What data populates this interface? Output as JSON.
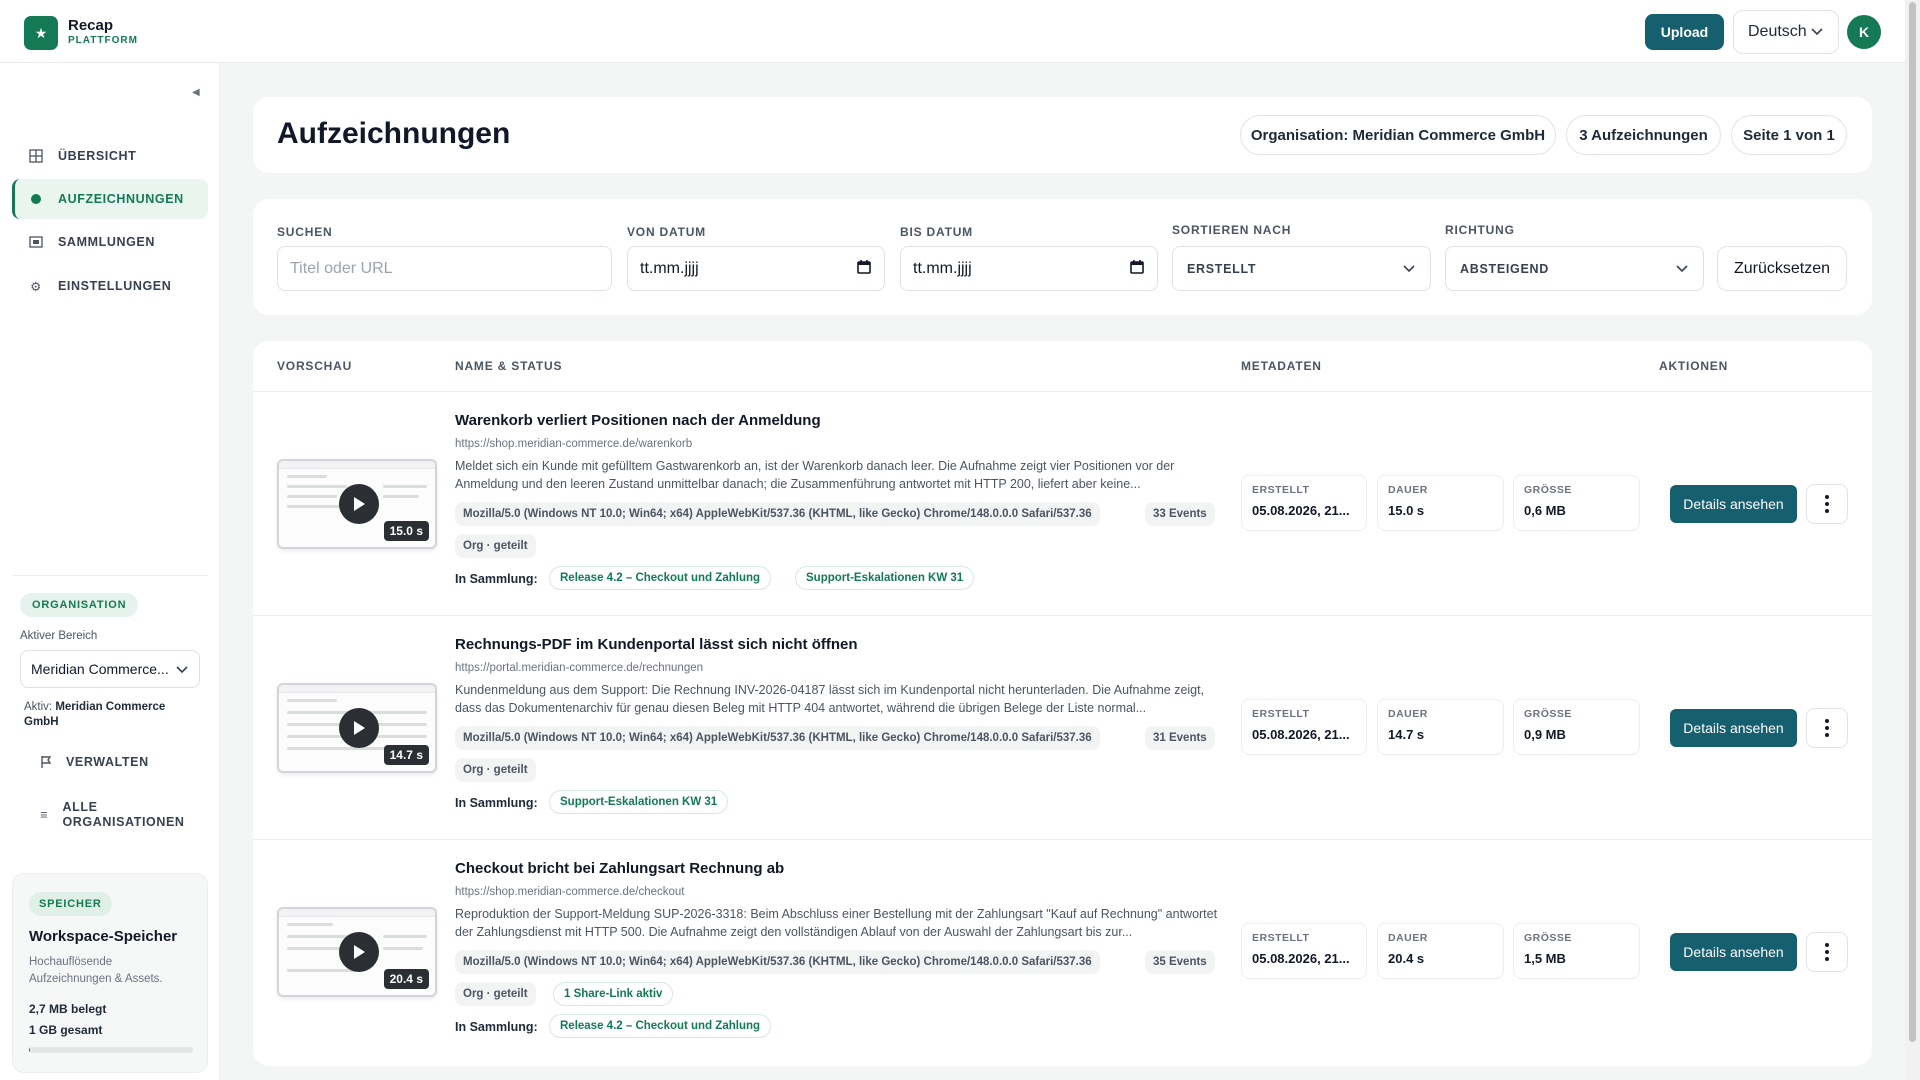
{
  "app": {
    "name": "Recap",
    "subtitle": "PLATTFORM"
  },
  "header": {
    "upload_label": "Upload",
    "language": "Deutsch",
    "avatar_initial": "K"
  },
  "sidebar": {
    "nav": [
      {
        "label": "ÜBERSICHT",
        "icon": "grid-icon",
        "active": false
      },
      {
        "label": "AUFZEICHNUNGEN",
        "icon": "record-dot-icon",
        "active": true
      },
      {
        "label": "SAMMLUNGEN",
        "icon": "collection-icon",
        "active": false
      },
      {
        "label": "EINSTELLUNGEN",
        "icon": "gear-icon",
        "active": false
      }
    ],
    "org_pill": "ORGANISATION",
    "area_label": "Aktiver Bereich",
    "org_select_value": "Meridian Commerce...",
    "active_prefix": "Aktiv:",
    "active_org": "Meridian Commerce GmbH",
    "manage_label": "VERWALTEN",
    "all_orgs_label": "ALLE ORGANISATIONEN",
    "storage": {
      "pill": "SPEICHER",
      "title": "Workspace-Speicher",
      "desc": "Hochauflösende Aufzeichnungen & Assets.",
      "used": "2,7 MB belegt",
      "total": "1 GB gesamt",
      "used_fraction": 0.0027
    }
  },
  "main": {
    "title": "Aufzeichnungen",
    "chips": {
      "organisation": "Organisation: Meridian Commerce GmbH",
      "count": "3 Aufzeichnungen",
      "page": "Seite 1 von 1"
    },
    "filters": {
      "search_label": "SUCHEN",
      "search_placeholder": "Titel oder URL",
      "from_label": "VON DATUM",
      "from_value": "tt.mm.jjjj",
      "to_label": "BIS DATUM",
      "to_value": "tt.mm.jjjj",
      "sort_label": "SORTIEREN NACH",
      "sort_value": "ERSTELLT",
      "dir_label": "RICHTUNG",
      "dir_value": "ABSTEIGEND",
      "reset_label": "Zurücksetzen"
    },
    "table": {
      "headers": {
        "preview": "VORSCHAU",
        "name": "NAME & STATUS",
        "meta": "METADATEN",
        "actions": "AKTIONEN"
      },
      "in_collection_label": "In Sammlung:",
      "meta_labels": {
        "created": "ERSTELLT",
        "duration": "DAUER",
        "size": "GRÖSSE"
      },
      "details_label": "Details ansehen",
      "rows": [
        {
          "title": "Warenkorb verliert Positionen nach der Anmeldung",
          "url": "https://shop.meridian-commerce.de/warenkorb",
          "desc": "Meldet sich ein Kunde mit gefülltem Gastwarenkorb an, ist der Warenkorb danach leer. Die Aufnahme zeigt vier Positionen vor der Anmeldung und den leeren Zustand unmittelbar danach; die Zusammenführung antwortet mit HTTP 200, liefert aber keine...",
          "user_agent": "Mozilla/5.0 (Windows NT 10.0; Win64; x64) AppleWebKit/537.36 (KHTML, like Gecko) Chrome/148.0.0.0 Safari/537.36",
          "events": "33 Events",
          "badges": [
            "Org · geteilt"
          ],
          "collections": [
            "Release 4.2 – Checkout und Zahlung",
            "Support-Eskalationen KW 31"
          ],
          "duration_badge": "15.0 s",
          "created": "05.08.2026, 21...",
          "duration": "15.0 s",
          "size": "0,6 MB"
        },
        {
          "title": "Rechnungs-PDF im Kundenportal lässt sich nicht öffnen",
          "url": "https://portal.meridian-commerce.de/rechnungen",
          "desc": "Kundenmeldung aus dem Support: Die Rechnung INV-2026-04187 lässt sich im Kundenportal nicht herunterladen. Die Aufnahme zeigt, dass das Dokumentenarchiv für genau diesen Beleg mit HTTP 404 antwortet, während die übrigen Belege der Liste normal...",
          "user_agent": "Mozilla/5.0 (Windows NT 10.0; Win64; x64) AppleWebKit/537.36 (KHTML, like Gecko) Chrome/148.0.0.0 Safari/537.36",
          "events": "31 Events",
          "badges": [
            "Org · geteilt"
          ],
          "collections": [
            "Support-Eskalationen KW 31"
          ],
          "duration_badge": "14.7 s",
          "created": "05.08.2026, 21...",
          "duration": "14.7 s",
          "size": "0,9 MB"
        },
        {
          "title": "Checkout bricht bei Zahlungsart Rechnung ab",
          "url": "https://shop.meridian-commerce.de/checkout",
          "desc": "Reproduktion der Support-Meldung SUP-2026-3318: Beim Abschluss einer Bestellung mit der Zahlungsart \"Kauf auf Rechnung\" antwortet der Zahlungsdienst mit HTTP 500. Die Aufnahme zeigt den vollständigen Ablauf von der Auswahl der Zahlungsart bis zur...",
          "user_agent": "Mozilla/5.0 (Windows NT 10.0; Win64; x64) AppleWebKit/537.36 (KHTML, like Gecko) Chrome/148.0.0.0 Safari/537.36",
          "events": "35 Events",
          "badges": [
            "Org · geteilt",
            "1 Share-Link aktiv"
          ],
          "collections": [
            "Release 4.2 – Checkout und Zahlung"
          ],
          "duration_badge": "20.4 s",
          "created": "05.08.2026, 21...",
          "duration": "20.4 s",
          "size": "1,5 MB"
        }
      ]
    }
  },
  "colors": {
    "brand": "#137a55",
    "primary_button": "#155f6e"
  }
}
